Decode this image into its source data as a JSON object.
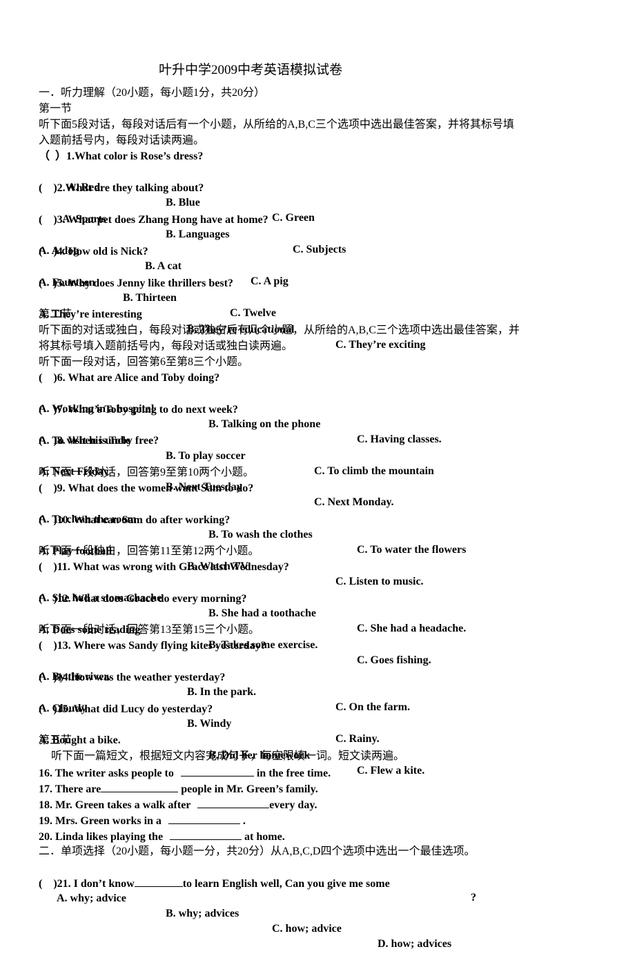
{
  "title": "叶升中学2009中考英语模拟试卷",
  "part1": {
    "heading": "一．听力理解（20小题，每小题1分，共20分）",
    "section1": {
      "label": "第一节",
      "instructions_line1": "听下面5段对话，每段对话后有一个小题，从所给的A,B,C三个选项中选出最佳答案，并将其标号填",
      "instructions_line2": "入题前括号内，每段对话读两遍。"
    },
    "section2": {
      "label": "第二节",
      "instructions_line1": "听下面的对话或独白，每段对话或独白后有几个小题，从所给的A,B,C三个选项中选出最佳答案，并",
      "instructions_line2": "将其标号填入题前括号内，每段对话或独白读两遍。",
      "group_6_8": "听下面一段对话，回答第6至第8三个小题。",
      "group_9_10": "听下面一段对话，回答第9至第10两个小题。",
      "group_11_12": "听下面一段独白，回答第11至第12两个小题。",
      "group_13_15": "听下面一段对话，回答第13至第15三个小题。"
    },
    "section3": {
      "label": "第三节",
      "instructions": "听下面一篇短文，根据短文内容完成句子，每空限填一词。短文读两遍。"
    }
  },
  "questions": [
    {
      "paren": "（  ）",
      "text": "1.What color is Rose’s dress?",
      "options": [
        "A. Red",
        "B. Blue",
        "C. Green"
      ]
    },
    {
      "paren": "(    )",
      "text": "2.What are they talking about?",
      "options": [
        "A. Sports",
        "B. Languages",
        "C. Subjects"
      ]
    },
    {
      "paren": "(    )",
      "text": "3. What pet does Zhang Hong have at home?",
      "options": [
        "A. A dog",
        "B. A cat",
        "C. A pig"
      ]
    },
    {
      "paren": "(    )",
      "text": "4. How old is Nick?",
      "options": [
        "A. Fourteen",
        "B. Thirteen",
        "C. Twelve"
      ]
    },
    {
      "paren": "(    )",
      "text": "5. Why does Jenny like thrillers best?",
      "options": [
        "A. They’re interesting",
        "B. They’re educational",
        "C. They’re exciting"
      ]
    },
    {
      "paren": "(    )",
      "text": "6. What are Alice and Toby doing?",
      "options": [
        "A. Working in a hospital",
        "B. Talking on the phone",
        "C. Having classes."
      ]
    },
    {
      "paren": "(    )",
      "text": "7. What’s Toby going to do next week?",
      "options": [
        "A. To visit his uncle",
        "B. To play soccer",
        "C. To climb the mountain"
      ]
    },
    {
      "paren": "(    )",
      "text": "8. When is Toby free?",
      "options": [
        "A. Next Friday",
        "B. Next Tuesday",
        "C. Next Monday."
      ]
    },
    {
      "paren": "(    )",
      "text": "9. What does the women want Sam to do?",
      "options": [
        "A. To clean the room",
        "B. To wash the clothes",
        "C. To water the flowers"
      ]
    },
    {
      "paren": "(    )",
      "text": "10. What can Sam do after working?",
      "options": [
        "A. Play football",
        "B. Watch TV",
        "C. Listen to music."
      ]
    },
    {
      "paren": "(    )",
      "text": "11. What was wrong with Grace last Wednesday?",
      "options": [
        "A. She had a stomachache",
        "B. She had a toothache",
        "C. She had a headache."
      ]
    },
    {
      "paren": "(    )",
      "text": "12. What does Grace do every morning?",
      "options": [
        "A. Does some reading",
        "B. Takes some exercise.",
        "C. Goes fishing."
      ]
    },
    {
      "paren": "(    )",
      "text": "13. Where was Sandy flying kites yesterday?",
      "options": [
        "A. By the river.",
        "B. In the park.",
        "C. On the farm."
      ]
    },
    {
      "paren": "(    )",
      "text": "14.How was the weather yesterday?",
      "options": [
        "A. Cloudy",
        "B. Windy",
        "C. Rainy."
      ]
    },
    {
      "paren": "(    )",
      "text": "15. What did Lucy do yesterday?",
      "options": [
        "A. Bought a bike.",
        "B. Did her homework",
        "C. Flew a kite."
      ]
    }
  ],
  "fill_blanks": [
    {
      "before": "16. The writer asks people to ",
      "after": " in the free time."
    },
    {
      "before": "17. There are",
      "after": " people in Mr. Green’s family."
    },
    {
      "before": "18. Mr. Green takes a walk after ",
      "after": "every day."
    },
    {
      "before": "19. Mrs. Green works in a ",
      "after": " ."
    },
    {
      "before": "20. Linda likes playing the ",
      "after": " at home."
    }
  ],
  "part2": {
    "heading": "二．单项选择（20小题，每小题一分，共20分）从A,B,C,D四个选项中选出一个最佳选项。",
    "q21": {
      "paren": "(    )",
      "text_before": "21. I don’t know",
      "text_middle": "to learn English well, Can you give me some",
      "text_end": "?",
      "options": [
        "A. why; advice",
        "B. why; advices",
        "C. how; advice",
        "D. how; advices"
      ]
    }
  }
}
